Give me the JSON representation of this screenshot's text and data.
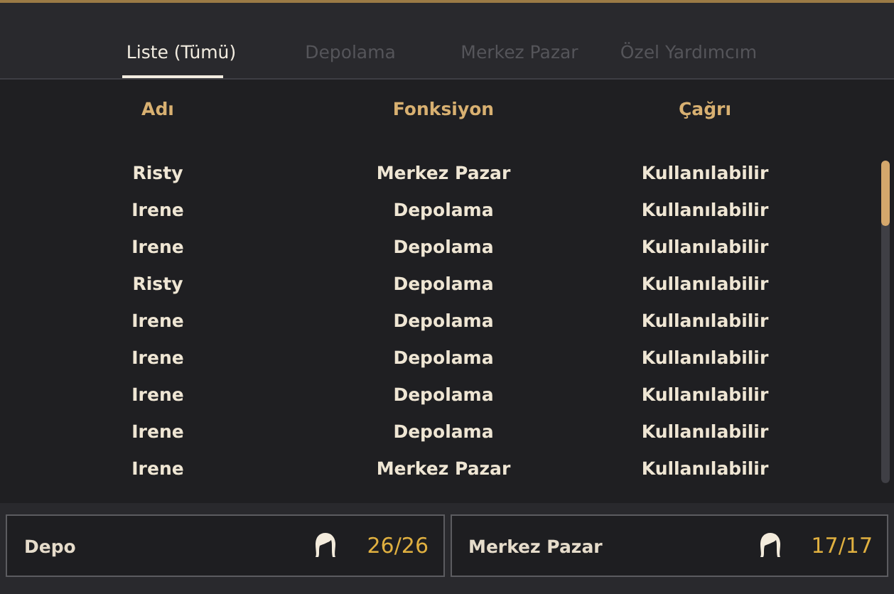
{
  "tabs": [
    {
      "label": "Liste (Tümü)",
      "selected": true
    },
    {
      "label": "Depolama",
      "selected": false
    },
    {
      "label": "Merkez Pazar",
      "selected": false
    },
    {
      "label": "Özel Yardımcım",
      "selected": false
    }
  ],
  "table": {
    "columns": [
      "Adı",
      "Fonksiyon",
      "Çağrı"
    ],
    "rows": [
      [
        "Risty",
        "Merkez Pazar",
        "Kullanılabilir"
      ],
      [
        "Irene",
        "Depolama",
        "Kullanılabilir"
      ],
      [
        "Irene",
        "Depolama",
        "Kullanılabilir"
      ],
      [
        "Risty",
        "Depolama",
        "Kullanılabilir"
      ],
      [
        "Irene",
        "Depolama",
        "Kullanılabilir"
      ],
      [
        "Irene",
        "Depolama",
        "Kullanılabilir"
      ],
      [
        "Irene",
        "Depolama",
        "Kullanılabilir"
      ],
      [
        "Irene",
        "Depolama",
        "Kullanılabilir"
      ],
      [
        "Irene",
        "Merkez Pazar",
        "Kullanılabilir"
      ]
    ]
  },
  "summary": [
    {
      "label": "Depo",
      "count": "26/26"
    },
    {
      "label": "Merkez Pazar",
      "count": "17/17"
    }
  ]
}
